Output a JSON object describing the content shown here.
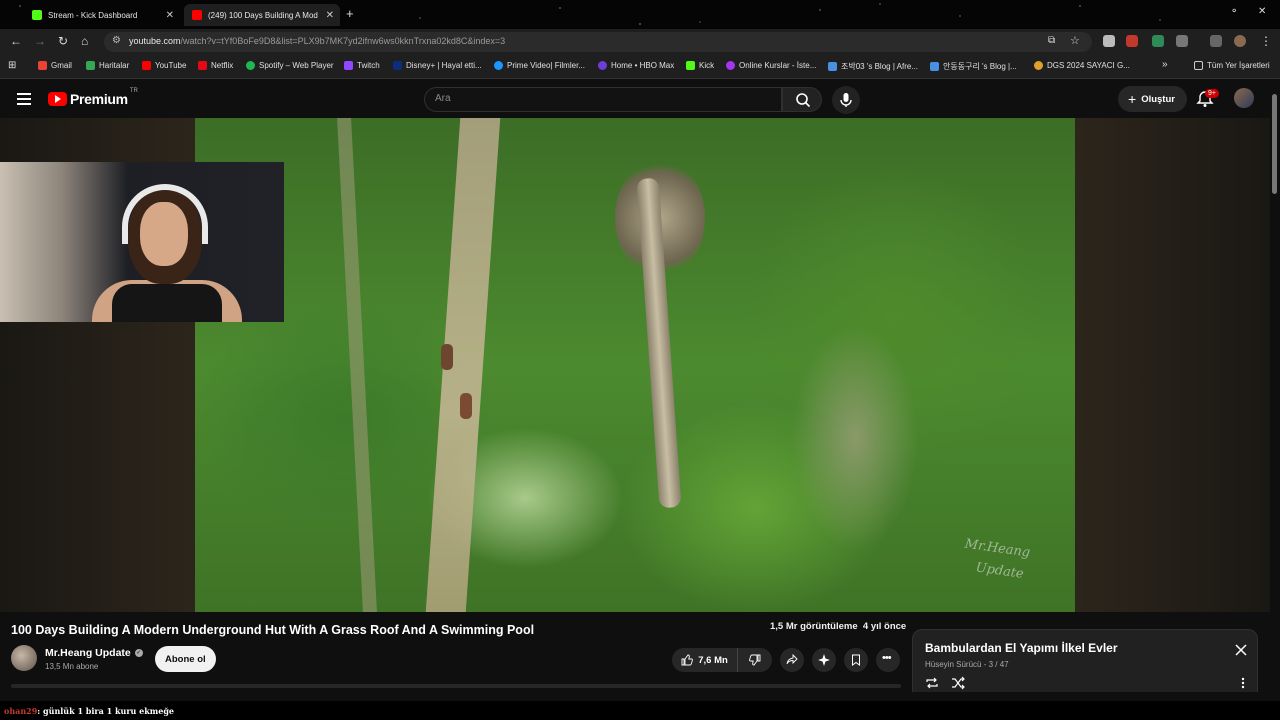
{
  "browser": {
    "tabs": [
      {
        "label": "Stream - Kick Dashboard",
        "active": false,
        "icon": "kick-icon",
        "color": "#53fc18"
      },
      {
        "label": "(249) 100 Days Building A Mod",
        "active": true,
        "icon": "youtube-icon",
        "color": "#ff0000"
      }
    ],
    "url_host": "youtube.com",
    "url_path": "/watch?v=tYf0BoFe9D8&list=PLX9b7MK7yd2ifnw6ws0kknTrxna02kd8C&index=3",
    "bookmarks": [
      {
        "label": "Gmail",
        "icon": "gmail-icon",
        "color": "#ea4335"
      },
      {
        "label": "Haritalar",
        "icon": "maps-icon",
        "color": "#34a853"
      },
      {
        "label": "YouTube",
        "icon": "youtube-icon",
        "color": "#ff0000"
      },
      {
        "label": "Netflix",
        "icon": "netflix-icon",
        "color": "#e50914"
      },
      {
        "label": "Spotify – Web Player",
        "icon": "spotify-icon",
        "color": "#1db954"
      },
      {
        "label": "Twitch",
        "icon": "twitch-icon",
        "color": "#9146ff"
      },
      {
        "label": "Disney+ | Hayal etti...",
        "icon": "disney-icon",
        "color": "#0c2c7d"
      },
      {
        "label": "Prime Video| Filmler...",
        "icon": "prime-icon",
        "color": "#1a98ff"
      },
      {
        "label": "Home • HBO Max",
        "icon": "hbo-icon",
        "color": "#6e3cd8"
      },
      {
        "label": "Kick",
        "icon": "kick-icon",
        "color": "#53fc18"
      },
      {
        "label": "Online Kurslar - İste...",
        "icon": "udemy-icon",
        "color": "#a435f0"
      },
      {
        "label": "조박03 's Blog | Afre...",
        "icon": "blog-icon",
        "color": "#4a90e2"
      },
      {
        "label": "안동동구리 's Blog |...",
        "icon": "blog-icon",
        "color": "#4a90e2"
      },
      {
        "label": "DGS 2024 SAYACI G...",
        "icon": "pin-icon",
        "color": "#e0a030"
      }
    ],
    "bookmarks_more": "»",
    "all_bookmarks": "Tüm Yer İşaretleri"
  },
  "youtube": {
    "brand": "Premium",
    "region": "TR",
    "search_placeholder": "Ara",
    "create_label": "Oluştur",
    "notifications_badge": "9+",
    "brand_color": "#ff0000"
  },
  "video": {
    "watermark_line1": "Mr.Heang",
    "watermark_line2": "Update",
    "title": "100 Days Building A Modern Underground Hut With A Grass Roof And A Swimming Pool",
    "views": "1,5 Mr görüntüleme",
    "age": "4 yıl önce",
    "channel": "Mr.Heang Update",
    "subscribers": "13,5 Mn abone",
    "subscribe_label": "Abone ol",
    "likes": "7,6 Mn"
  },
  "playlist": {
    "title": "Bambulardan El Yapımı İlkel Evler",
    "owner": "Hüseyin Sürücü",
    "position": "3 / 47"
  },
  "chat": {
    "user": "ohan29",
    "message": ": günlük 1 bira 1 kuru ekmeğe"
  }
}
